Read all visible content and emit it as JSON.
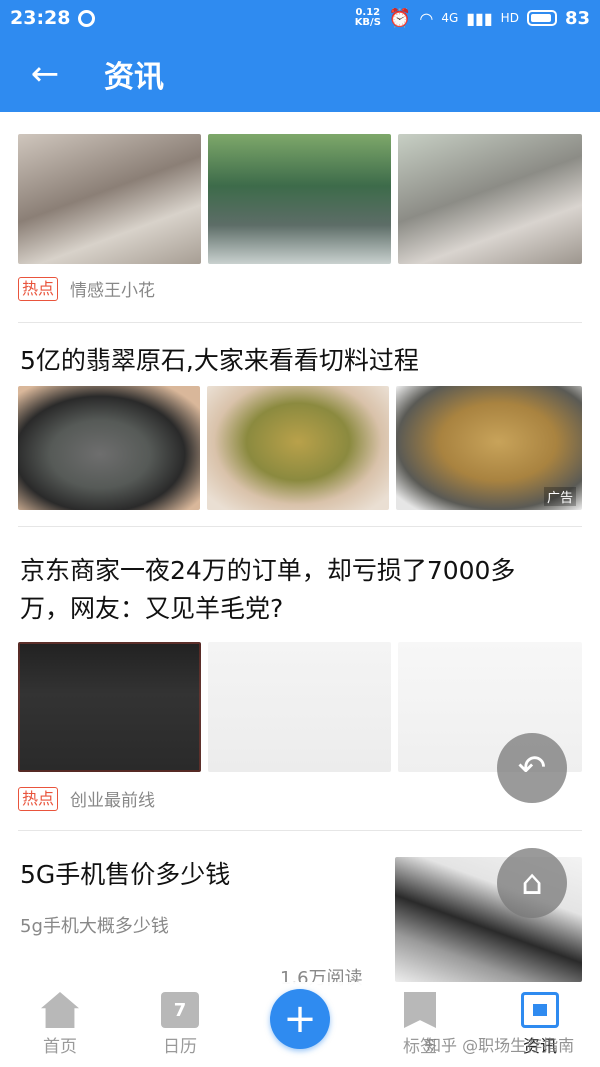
{
  "status": {
    "time": "23:28",
    "speed_top": "0.12",
    "speed_bottom": "KB/S",
    "net": "4G",
    "hd": "HD",
    "battery": "83"
  },
  "header": {
    "title": "资讯"
  },
  "feed": {
    "item1": {
      "tag": "热点",
      "source": "情感王小花"
    },
    "item2": {
      "title": "5亿的翡翠原石,大家来看看切料过程",
      "ad": "广告"
    },
    "item3": {
      "title_line1": "京东商家一夜24万的订单，却亏损了7000多",
      "title_line2": "万，网友：又见羊毛党?",
      "tag": "热点",
      "source": "创业最前线"
    },
    "item4": {
      "title": "5G手机售价多少钱",
      "subtitle": "5g手机大概多少钱",
      "reads": "1.6万阅读"
    }
  },
  "tabbar": {
    "home": "首页",
    "calendar": "日历",
    "calendar_day": "7",
    "tags": "标签",
    "news": "资讯"
  },
  "watermark": "知乎 @职场生存指南",
  "colors": {
    "primary": "#2f8bf0",
    "hot": "#e9543c"
  }
}
